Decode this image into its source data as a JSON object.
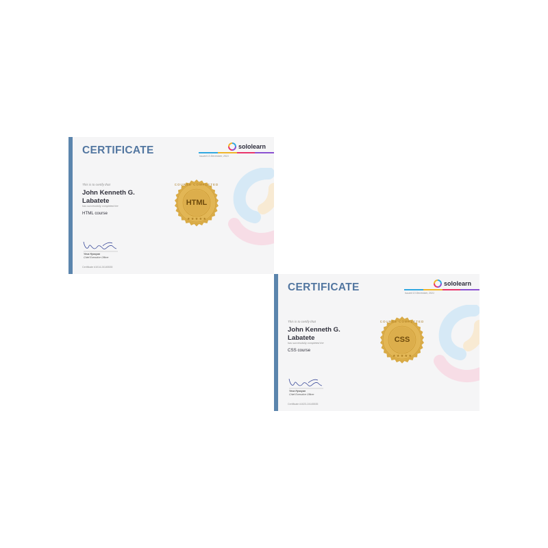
{
  "colors": {
    "accent_bar": "#5b85ad",
    "title": "#5276a0",
    "seal_gold": "#d8aa45",
    "stripe": [
      "#2fa7e0",
      "#f0b429",
      "#e8336a",
      "#8a4fd1"
    ]
  },
  "icons": [
    "sololearn-logo-icon",
    "course-completed-seal-icon",
    "signature-icon",
    "sololearn-watermark-icon"
  ],
  "certificates": [
    {
      "title": "CERTIFICATE",
      "brand": "sololearn",
      "issued": "Issued 13 December, 2021",
      "certify_text": "This is to certify that",
      "name_line1": "John Kenneth G.",
      "name_line2": "Labatete",
      "completed_text": "has successfully completed the",
      "course": "HTML course",
      "seal_text": "HTML",
      "seal_ring_text": "COURSE COMPLETED",
      "signer": "Yeva Hyusyan",
      "role": "Chief Executive Officer",
      "cert_number": "Certificate #1014-24145535"
    },
    {
      "title": "CERTIFICATE",
      "brand": "sololearn",
      "issued": "Issued 13 December, 2021",
      "certify_text": "This is to certify that",
      "name_line1": "John Kenneth G.",
      "name_line2": "Labatete",
      "completed_text": "has successfully completed the",
      "course": "CSS course",
      "seal_text": "CSS",
      "seal_ring_text": "COURSE COMPLETED",
      "signer": "Yeva Hyusyan",
      "role": "Chief Executive Officer",
      "cert_number": "Certificate #1023-24145535"
    }
  ]
}
